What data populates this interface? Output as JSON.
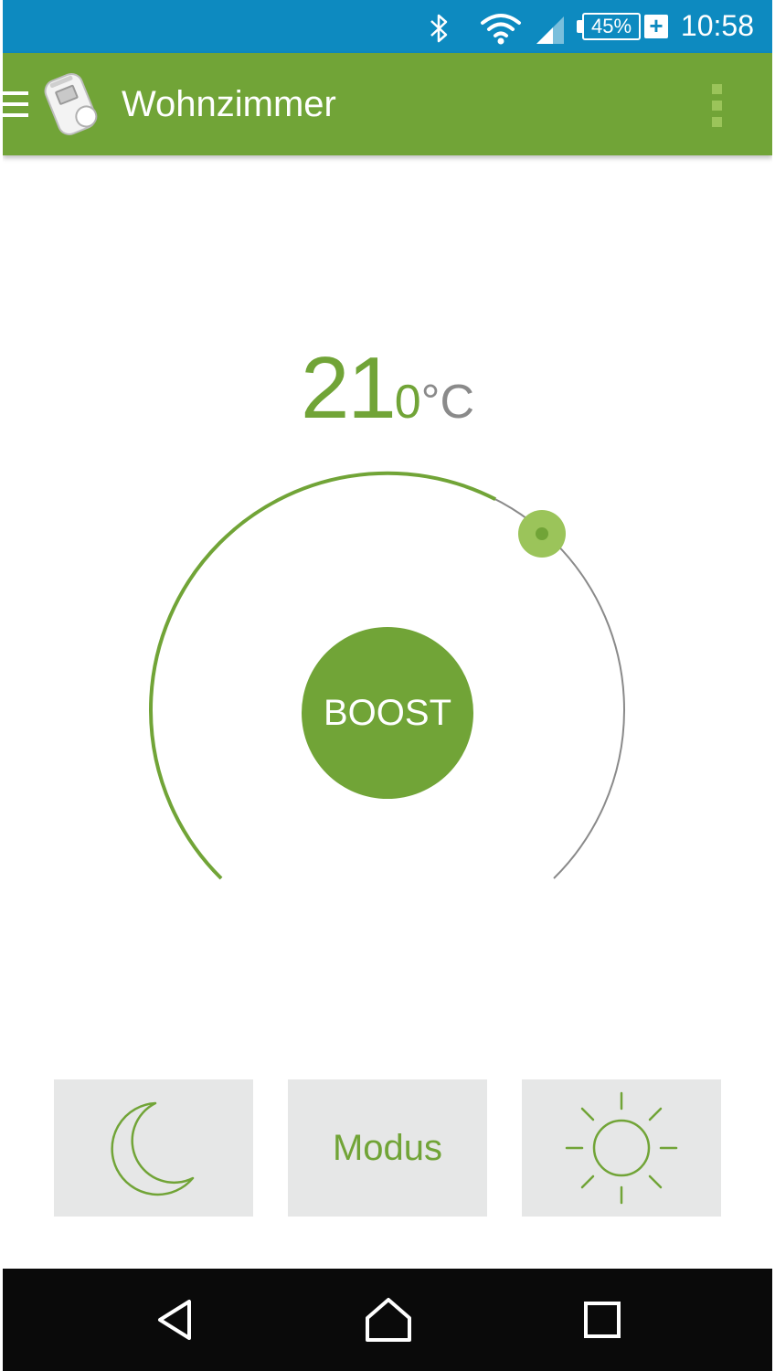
{
  "status_bar": {
    "time": "10:58",
    "battery_percent": "45%",
    "icons": [
      "bluetooth-icon",
      "wifi-icon",
      "cell-signal-icon",
      "battery-icon",
      "charging-icon"
    ]
  },
  "app_bar": {
    "title": "Wohnzimmer",
    "icons": [
      "menu-icon",
      "thermostat-device-icon",
      "overflow-menu-icon"
    ]
  },
  "thermostat": {
    "temp_integer": "21",
    "temp_fraction": "0",
    "temp_unit": "°C",
    "boost_label": "BOOST",
    "dial_fill_fraction": 0.6
  },
  "modes": {
    "night_icon": "moon-icon",
    "modus_label": "Modus",
    "day_icon": "sun-icon"
  },
  "nav_bar": {
    "icons": [
      "back-icon",
      "home-icon",
      "recents-icon"
    ]
  },
  "colors": {
    "status_bar": "#0d8ac0",
    "accent_green": "#71a437",
    "knob_green": "#9bc45a",
    "mode_button_bg": "#e6e7e7",
    "nav_bar": "#0a0a0a",
    "unit_gray": "#8a8a8a"
  }
}
